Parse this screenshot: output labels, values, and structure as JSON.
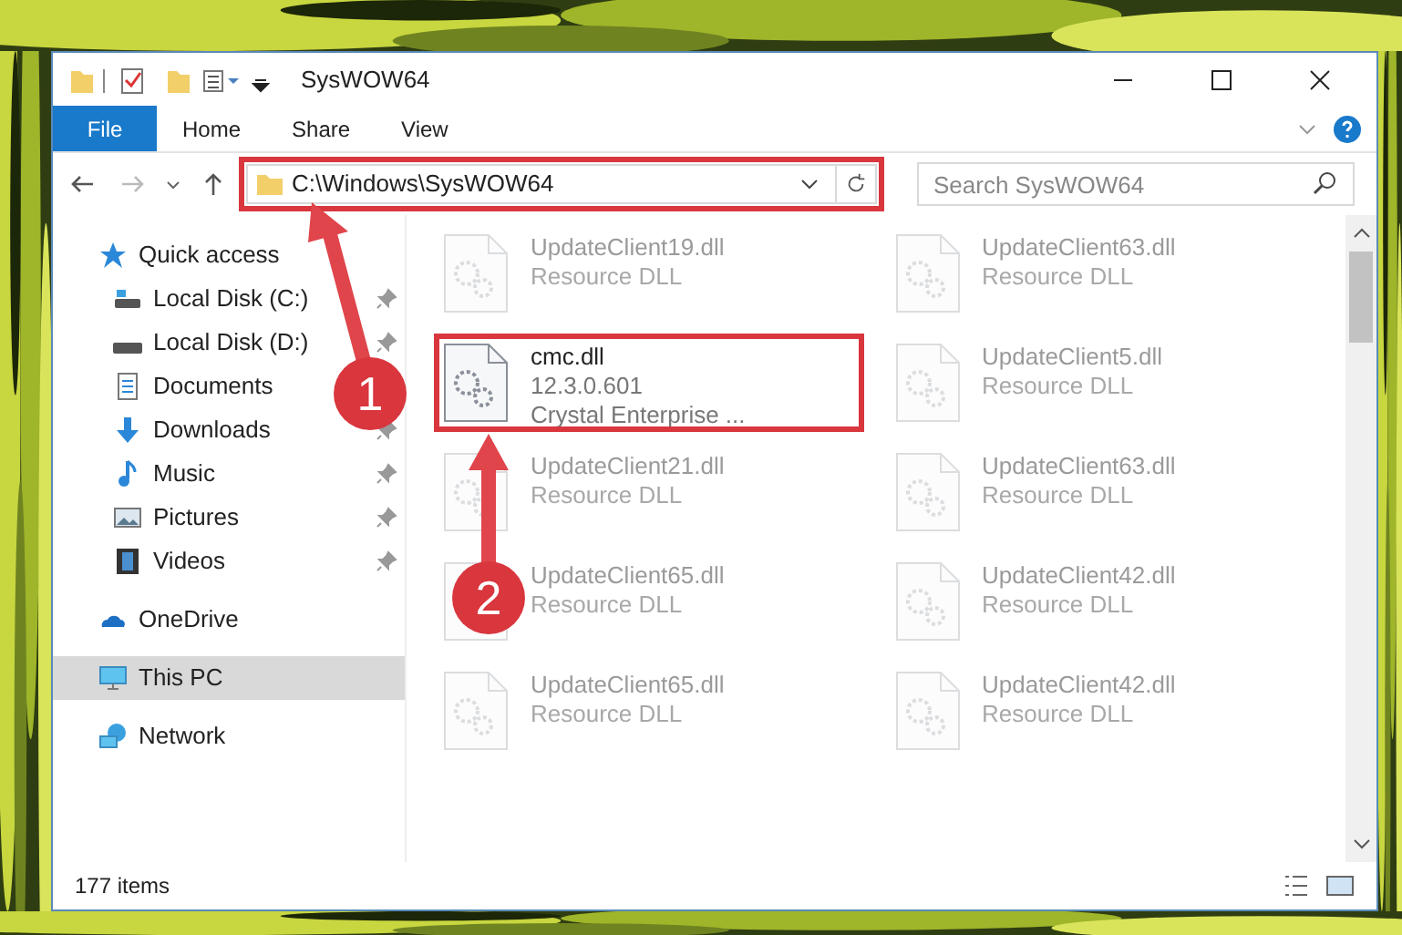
{
  "window": {
    "title": "SysWOW64"
  },
  "ribbon_tabs": [
    {
      "label": "File",
      "kind": "file"
    },
    {
      "label": "Home",
      "kind": "tab"
    },
    {
      "label": "Share",
      "kind": "tab"
    },
    {
      "label": "View",
      "kind": "tab"
    }
  ],
  "address": {
    "path": "C:\\Windows\\SysWOW64"
  },
  "search": {
    "placeholder": "Search SysWOW64"
  },
  "nav": [
    {
      "label": "Quick access",
      "kind": "quick",
      "selected": false,
      "children": [
        {
          "label": "Local Disk (C:)",
          "kind": "drive_c",
          "pinned": true
        },
        {
          "label": "Local Disk (D:)",
          "kind": "drive",
          "pinned": true
        },
        {
          "label": "Documents",
          "kind": "documents",
          "pinned": false
        },
        {
          "label": "Downloads",
          "kind": "downloads",
          "pinned": true
        },
        {
          "label": "Music",
          "kind": "music",
          "pinned": true
        },
        {
          "label": "Pictures",
          "kind": "pictures",
          "pinned": true
        },
        {
          "label": "Videos",
          "kind": "videos",
          "pinned": true
        }
      ]
    },
    {
      "label": "OneDrive",
      "kind": "onedrive",
      "selected": false
    },
    {
      "label": "This PC",
      "kind": "pc",
      "selected": true
    },
    {
      "label": "Network",
      "kind": "network",
      "selected": false
    }
  ],
  "files": [
    {
      "name": "UpdateClient19.dll",
      "details": [
        "Resource DLL"
      ],
      "faded": true
    },
    {
      "name": "UpdateClient63.dll",
      "details": [
        "Resource DLL"
      ],
      "faded": true
    },
    {
      "name": "cmc.dll",
      "details": [
        "12.3.0.601",
        "Crystal Enterprise ..."
      ],
      "faded": false
    },
    {
      "name": "UpdateClient5.dll",
      "details": [
        "Resource DLL"
      ],
      "faded": true
    },
    {
      "name": "UpdateClient21.dll",
      "details": [
        "Resource DLL"
      ],
      "faded": true
    },
    {
      "name": "UpdateClient63.dll",
      "details": [
        "Resource DLL"
      ],
      "faded": true
    },
    {
      "name": "UpdateClient65.dll",
      "details": [
        "Resource DLL"
      ],
      "faded": true
    },
    {
      "name": "UpdateClient42.dll",
      "details": [
        "Resource DLL"
      ],
      "faded": true
    },
    {
      "name": "UpdateClient65.dll",
      "details": [
        "Resource DLL"
      ],
      "faded": true
    },
    {
      "name": "UpdateClient42.dll",
      "details": [
        "Resource DLL"
      ],
      "faded": true
    }
  ],
  "status_bar": {
    "count": "177 items"
  },
  "annotations": [
    {
      "label": "1"
    },
    {
      "label": "2"
    }
  ]
}
